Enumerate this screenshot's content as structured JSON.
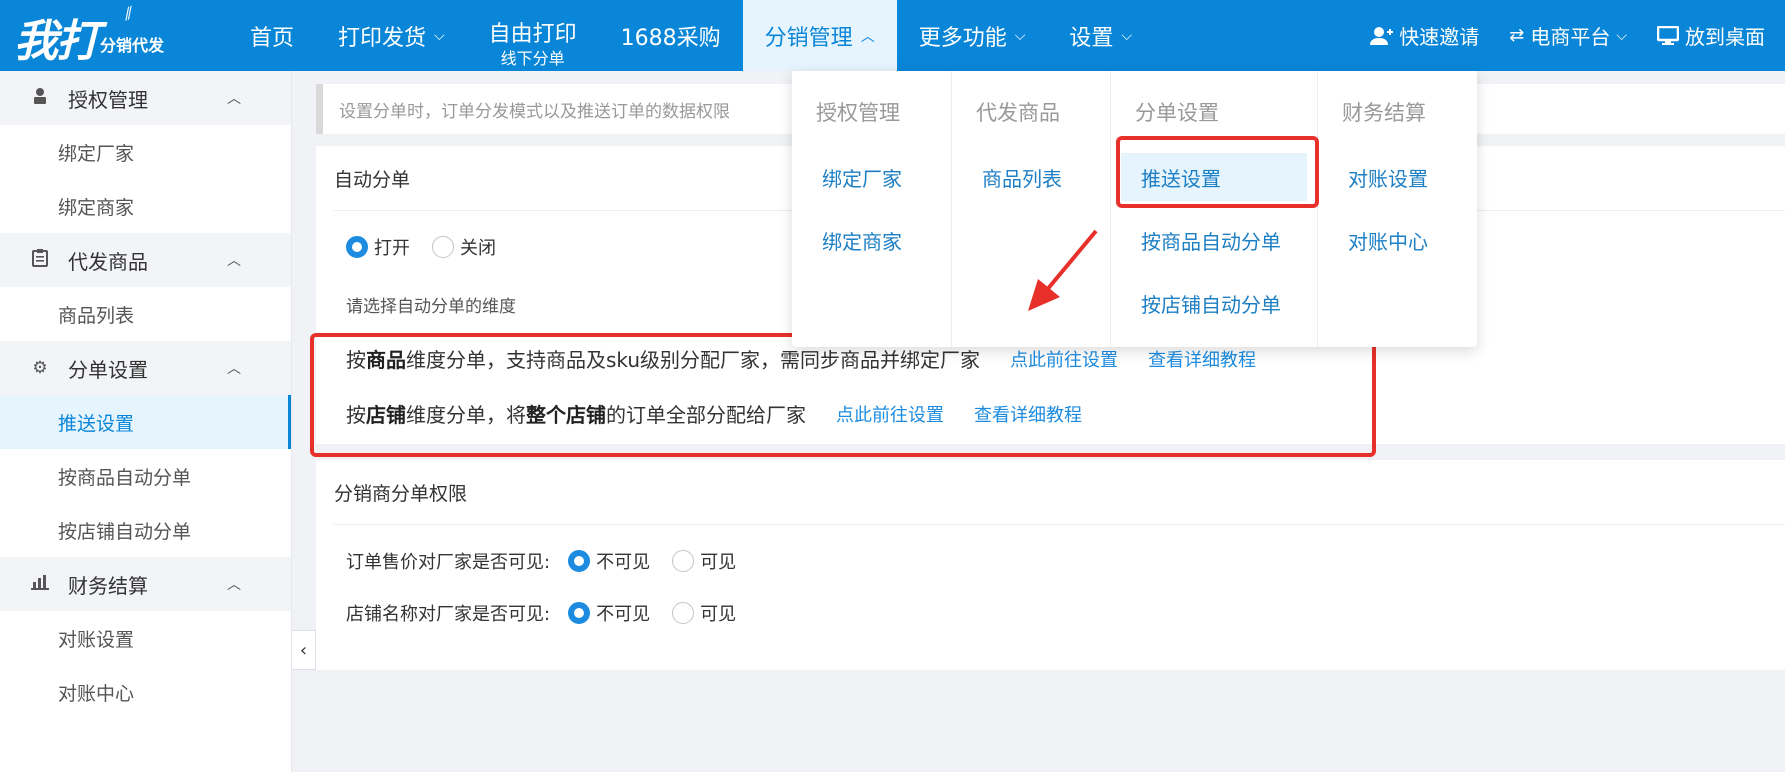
{
  "logo": {
    "main": "我打",
    "sub": "分销代发"
  },
  "nav": {
    "items": [
      {
        "label": "首页"
      },
      {
        "label": "打印发货"
      },
      {
        "label": "自由打印",
        "sub": "线下分单"
      },
      {
        "label": "1688采购"
      },
      {
        "label": "分销管理"
      },
      {
        "label": "更多功能"
      },
      {
        "label": "设置"
      }
    ],
    "right": [
      {
        "label": "快速邀请"
      },
      {
        "label": "电商平台"
      },
      {
        "label": "放到桌面"
      }
    ]
  },
  "sidebar": {
    "groups": [
      {
        "label": "授权管理",
        "items": [
          "绑定厂家",
          "绑定商家"
        ]
      },
      {
        "label": "代发商品",
        "items": [
          "商品列表"
        ]
      },
      {
        "label": "分单设置",
        "items": [
          "推送设置",
          "按商品自动分单",
          "按店铺自动分单"
        ]
      },
      {
        "label": "财务结算",
        "items": [
          "对账设置",
          "对账中心"
        ]
      }
    ],
    "active_item": "推送设置"
  },
  "hint": "设置分单时，订单分发模式以及推送订单的数据权限",
  "auto_split": {
    "title": "自动分单",
    "options": [
      "打开",
      "关闭"
    ],
    "selected": "打开",
    "dimension_label": "请选择自动分单的维度",
    "line1": {
      "pre": "按",
      "bold": "商品",
      "post": "维度分单，支持商品及sku级别分配厂家，需同步商品并绑定厂家",
      "link1": "点此前往设置",
      "link2": "查看详细教程"
    },
    "line2": {
      "pre": "按",
      "bold1": "店铺",
      "mid": "维度分单，将",
      "bold2": "整个店铺",
      "post": "的订单全部分配给厂家",
      "link1": "点此前往设置",
      "link2": "查看详细教程"
    }
  },
  "permissions": {
    "title": "分销商分单权限",
    "rows": [
      {
        "label": "订单售价对厂家是否可见:",
        "options": [
          "不可见",
          "可见"
        ],
        "selected": "不可见"
      },
      {
        "label": "店铺名称对厂家是否可见:",
        "options": [
          "不可见",
          "可见"
        ],
        "selected": "不可见"
      }
    ]
  },
  "dropdown": {
    "columns": [
      {
        "head": "授权管理",
        "items": [
          "绑定厂家",
          "绑定商家"
        ]
      },
      {
        "head": "代发商品",
        "items": [
          "商品列表"
        ]
      },
      {
        "head": "分单设置",
        "items": [
          "推送设置",
          "按商品自动分单",
          "按店铺自动分单"
        ]
      },
      {
        "head": "财务结算",
        "items": [
          "对账设置",
          "对账中心"
        ]
      }
    ],
    "active_item": "推送设置"
  },
  "colors": {
    "primary": "#0a86d8",
    "link": "#1d8ce0",
    "highlight": "#e8302a"
  }
}
